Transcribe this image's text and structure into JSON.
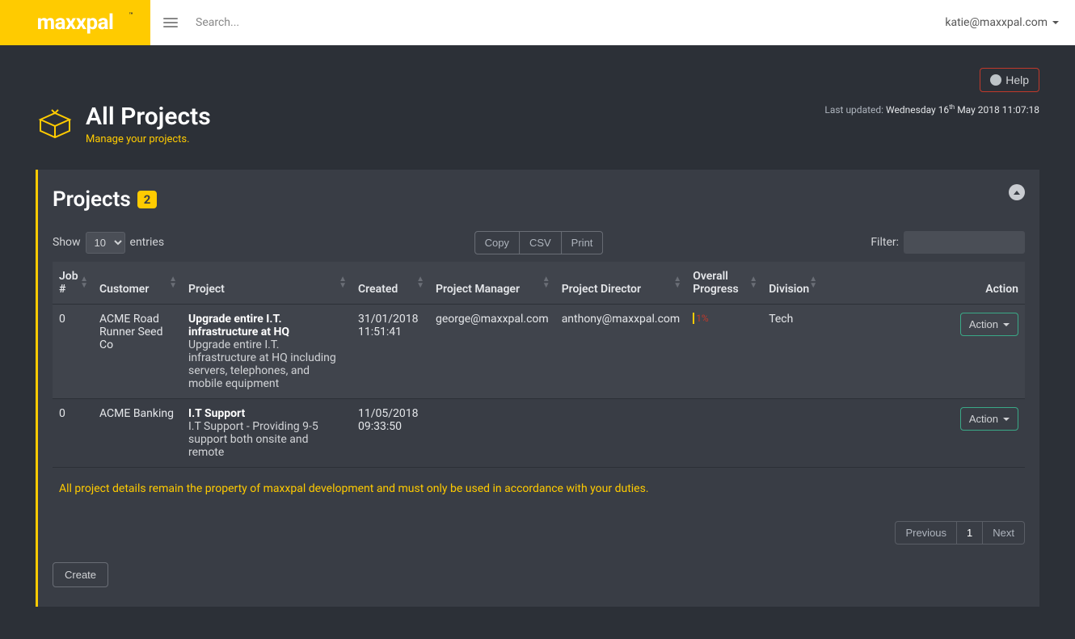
{
  "header": {
    "logo": "maxxpal",
    "search_placeholder": "Search...",
    "user_email": "katie@maxxpal.com"
  },
  "help_button": "Help",
  "page": {
    "title": "All Projects",
    "subtitle": "Manage your projects.",
    "last_updated_label": "Last updated:",
    "last_updated_day": "Wednesday 16",
    "last_updated_suffix": "th",
    "last_updated_rest": " May 2018 11:07:18"
  },
  "panel": {
    "title": "Projects",
    "count": "2",
    "show_label": "Show",
    "entries_label": "entries",
    "entries_value": "10",
    "export": {
      "copy": "Copy",
      "csv": "CSV",
      "print": "Print"
    },
    "filter_label": "Filter:",
    "columns": {
      "job": "Job #",
      "customer": "Customer",
      "project": "Project",
      "created": "Created",
      "pm": "Project Manager",
      "pd": "Project Director",
      "progress": "Overall Progress",
      "division": "Division",
      "action": "Action"
    },
    "rows": [
      {
        "job": "0",
        "customer": "ACME Road Runner Seed Co",
        "project_name": "Upgrade entire I.T. infrastructure at HQ",
        "project_desc": "Upgrade entire I.T. infrastructure at HQ including servers, telephones, and mobile equipment",
        "created": "31/01/2018 11:51:41",
        "pm": "george@maxxpal.com",
        "pd": "anthony@maxxpal.com",
        "progress": "1%",
        "division": "Tech",
        "action": "Action"
      },
      {
        "job": "0",
        "customer": "ACME Banking",
        "project_name": "I.T Support",
        "project_desc": "I.T Support - Providing 9-5 support both onsite and remote",
        "created": "11/05/2018 09:33:50",
        "pm": "",
        "pd": "",
        "progress": "",
        "division": "",
        "action": "Action"
      }
    ],
    "notice": "All project details remain the property of maxxpal development and must only be used in accordance with your duties.",
    "pagination": {
      "prev": "Previous",
      "page1": "1",
      "next": "Next"
    },
    "create": "Create"
  }
}
